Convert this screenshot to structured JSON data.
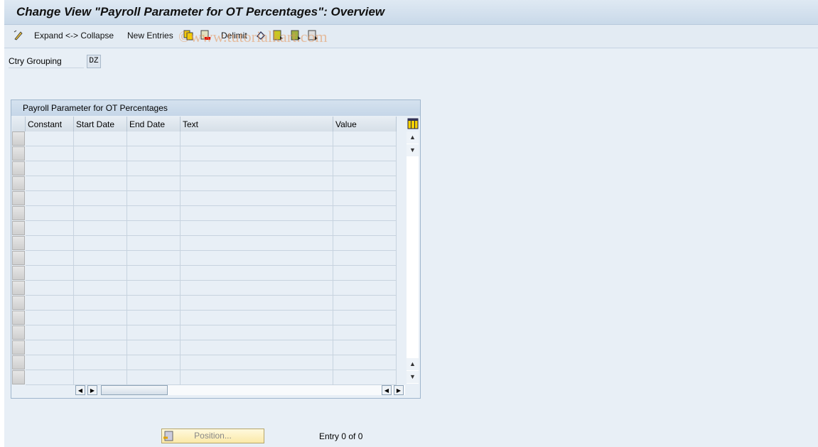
{
  "title": "Change View \"Payroll Parameter for OT Percentages\": Overview",
  "toolbar": {
    "expand_collapse": "Expand <-> Collapse",
    "new_entries": "New Entries",
    "delimit": "Delimit",
    "icons": [
      "display-change-icon",
      "copy-icon",
      "delete-icon",
      "undo-icon",
      "select-all-icon",
      "select-block-icon",
      "deselect-all-icon"
    ]
  },
  "watermark": "©www.tutorialkart.com",
  "filter": {
    "label": "Ctry Grouping",
    "value": "DZ"
  },
  "table": {
    "title": "Payroll Parameter for OT Percentages",
    "columns": [
      "Constant",
      "Start Date",
      "End Date",
      "Text",
      "Value"
    ],
    "rows": []
  },
  "footer": {
    "position_button": "Position...",
    "entry_count": "Entry 0 of 0"
  }
}
